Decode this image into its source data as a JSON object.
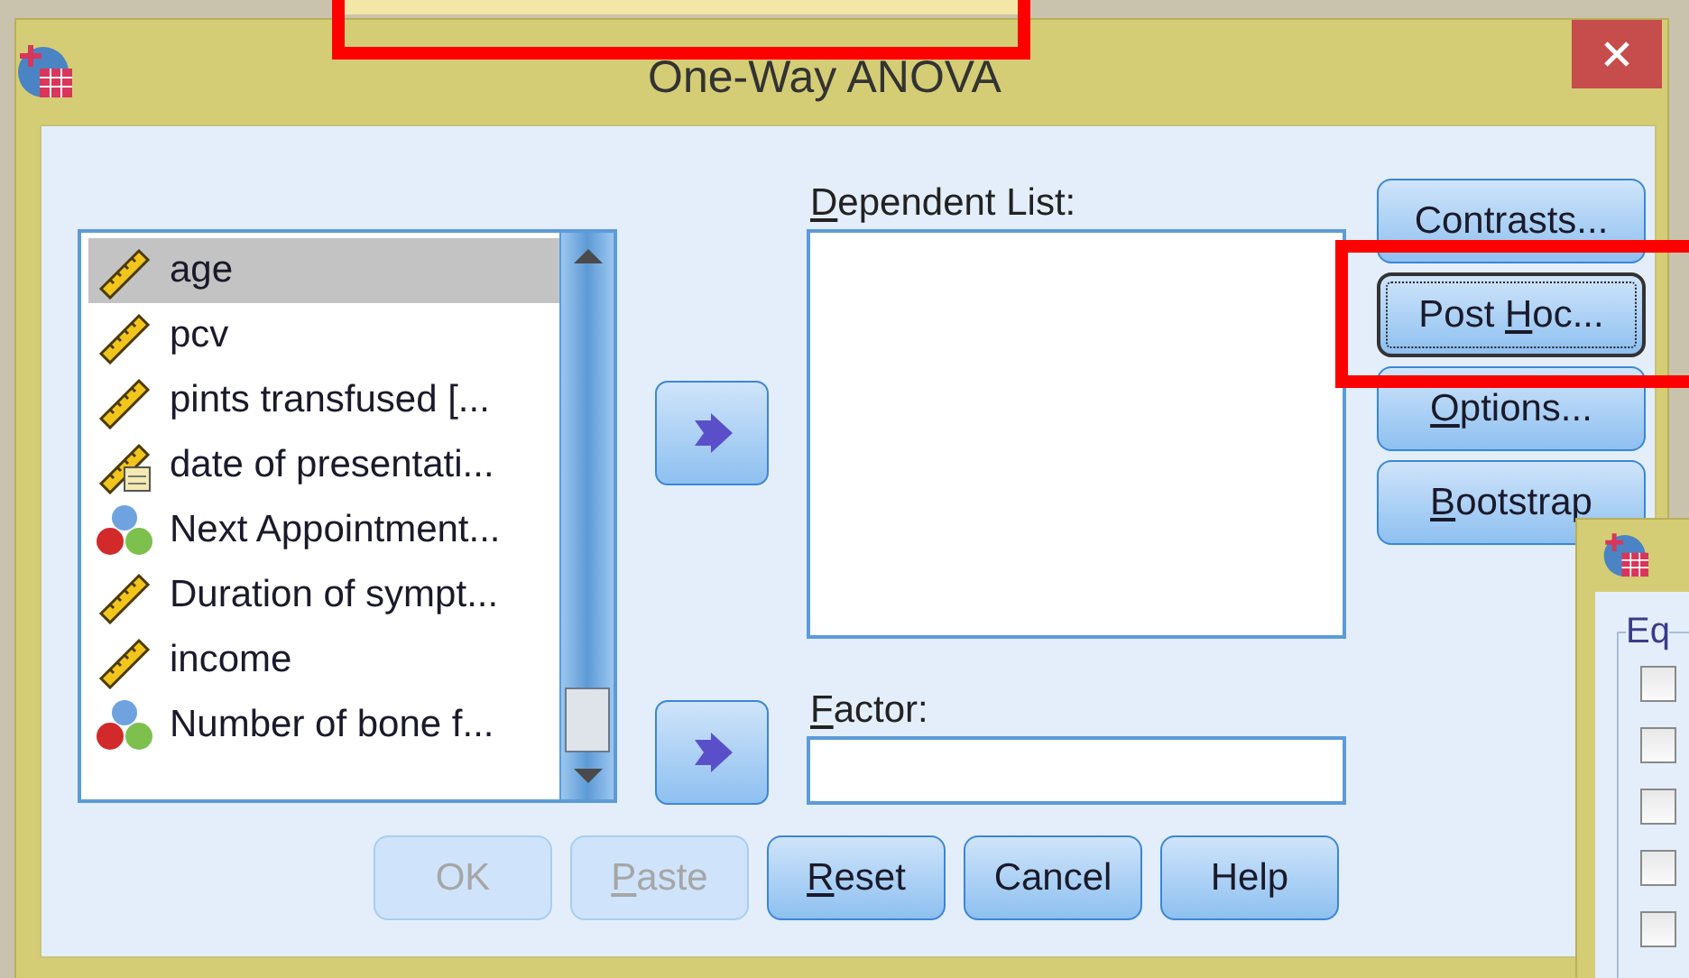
{
  "window": {
    "title": "One-Way ANOVA"
  },
  "variables": [
    {
      "label": "age",
      "kind": "scale",
      "selected": true
    },
    {
      "label": "pcv",
      "kind": "scale",
      "selected": false
    },
    {
      "label": "pints transfused [...",
      "kind": "scale",
      "selected": false
    },
    {
      "label": "date of presentati...",
      "kind": "date",
      "selected": false
    },
    {
      "label": "Next Appointment...",
      "kind": "nominal",
      "selected": false
    },
    {
      "label": "Duration of sympt...",
      "kind": "scale",
      "selected": false
    },
    {
      "label": "income",
      "kind": "scale",
      "selected": false
    },
    {
      "label": "Number of bone f...",
      "kind": "nominal",
      "selected": false
    }
  ],
  "dependent_list": {
    "label": {
      "key": "D",
      "after": "ependent List:"
    }
  },
  "factor": {
    "label": {
      "key": "F",
      "after": "actor:"
    }
  },
  "side_buttons": [
    {
      "label": "Contrasts...",
      "focused": false
    },
    {
      "label": {
        "before": "Post ",
        "key": "H",
        "after": "oc..."
      },
      "focused": true
    },
    {
      "label": {
        "key": "O",
        "after": "ptions..."
      },
      "focused": false
    },
    {
      "label": {
        "key": "B",
        "after": "ootstrap"
      },
      "focused": false
    }
  ],
  "bottom_buttons": [
    {
      "label": "OK",
      "disabled": true
    },
    {
      "label": {
        "key": "P",
        "after": "aste"
      },
      "disabled": true
    },
    {
      "label": {
        "key": "R",
        "after": "eset"
      },
      "disabled": false
    },
    {
      "label": "Cancel",
      "disabled": false
    },
    {
      "label": "Help",
      "disabled": false
    }
  ],
  "second_dialog": {
    "group_label": "Eq",
    "checkboxes": [
      {
        "checked": false
      },
      {
        "checked": false
      },
      {
        "checked": false
      },
      {
        "checked": false
      },
      {
        "checked": false
      }
    ]
  }
}
